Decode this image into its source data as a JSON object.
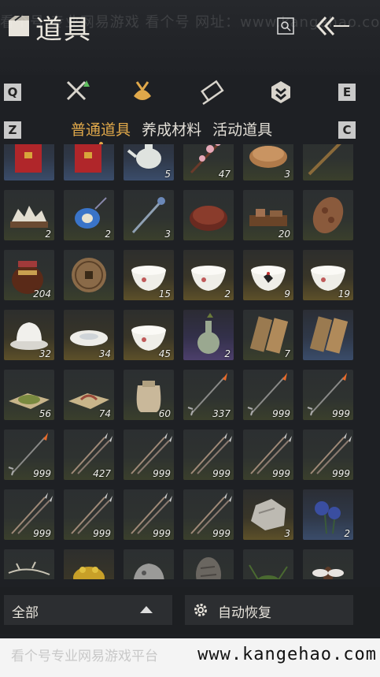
{
  "header": {
    "title": "道具",
    "watermark": "看个号  专业网易游戏  看个号  网址：www.kangehao.com"
  },
  "keys": {
    "left_top": "Q",
    "right_top": "E",
    "left_bottom": "Z",
    "right_bottom": "C"
  },
  "tabs": [
    {
      "label": "普通道具",
      "active": true
    },
    {
      "label": "养成材料",
      "active": false
    },
    {
      "label": "活动道具",
      "active": false
    }
  ],
  "items": [
    {
      "icon": "red-envelope-icon",
      "qty": "",
      "bg": "blue"
    },
    {
      "icon": "red-envelope-icon",
      "qty": "",
      "bg": "blue"
    },
    {
      "icon": "teapot-icon",
      "qty": "5",
      "bg": "blue"
    },
    {
      "icon": "flower-branch-icon",
      "qty": "47",
      "bg": ""
    },
    {
      "icon": "cake-icon",
      "qty": "3",
      "bg": ""
    },
    {
      "icon": "stick-icon",
      "qty": "",
      "bg": ""
    },
    {
      "icon": "rock-garden-icon",
      "qty": "2",
      "bg": ""
    },
    {
      "icon": "blue-pouch-icon",
      "qty": "2",
      "bg": ""
    },
    {
      "icon": "hairpin-icon",
      "qty": "3",
      "bg": ""
    },
    {
      "icon": "round-box-icon",
      "qty": "",
      "bg": ""
    },
    {
      "icon": "tray-icon",
      "qty": "20",
      "bg": ""
    },
    {
      "icon": "carved-comb-icon",
      "qty": "",
      "bg": ""
    },
    {
      "icon": "wine-jar-icon",
      "qty": "204",
      "bg": ""
    },
    {
      "icon": "bronze-coin-icon",
      "qty": "",
      "bg": ""
    },
    {
      "icon": "porcelain-bowl-icon",
      "qty": "15",
      "bg": "gold"
    },
    {
      "icon": "porcelain-bowl-icon",
      "qty": "2",
      "bg": "gold"
    },
    {
      "icon": "rooster-bowl-icon",
      "qty": "9",
      "bg": "gold"
    },
    {
      "icon": "porcelain-bowl-icon",
      "qty": "19",
      "bg": "gold"
    },
    {
      "icon": "covered-bowl-icon",
      "qty": "32",
      "bg": "gold"
    },
    {
      "icon": "dish-icon",
      "qty": "34",
      "bg": "gold"
    },
    {
      "icon": "porcelain-bowl-icon",
      "qty": "45",
      "bg": "gold"
    },
    {
      "icon": "vase-icon",
      "qty": "2",
      "bg": "purple"
    },
    {
      "icon": "wooden-tablet-icon",
      "qty": "7",
      "bg": ""
    },
    {
      "icon": "wooden-tablet-icon",
      "qty": "",
      "bg": "blue"
    },
    {
      "icon": "herb-powder-icon",
      "qty": "56",
      "bg": ""
    },
    {
      "icon": "worm-icon",
      "qty": "74",
      "bg": ""
    },
    {
      "icon": "sack-icon",
      "qty": "60",
      "bg": ""
    },
    {
      "icon": "fire-arrow-icon",
      "qty": "337",
      "bg": ""
    },
    {
      "icon": "fire-arrow-icon",
      "qty": "999",
      "bg": ""
    },
    {
      "icon": "fire-arrow-icon",
      "qty": "999",
      "bg": ""
    },
    {
      "icon": "fire-arrow-icon",
      "qty": "999",
      "bg": ""
    },
    {
      "icon": "arrow-icon",
      "qty": "427",
      "bg": ""
    },
    {
      "icon": "arrow-icon",
      "qty": "999",
      "bg": ""
    },
    {
      "icon": "arrow-icon",
      "qty": "999",
      "bg": ""
    },
    {
      "icon": "arrow-icon",
      "qty": "999",
      "bg": ""
    },
    {
      "icon": "arrow-icon",
      "qty": "999",
      "bg": ""
    },
    {
      "icon": "arrow-icon",
      "qty": "999",
      "bg": ""
    },
    {
      "icon": "arrow-icon",
      "qty": "999",
      "bg": ""
    },
    {
      "icon": "arrow-icon",
      "qty": "999",
      "bg": ""
    },
    {
      "icon": "arrow-icon",
      "qty": "999",
      "bg": ""
    },
    {
      "icon": "ore-icon",
      "qty": "3",
      "bg": "gold"
    },
    {
      "icon": "blue-flower-icon",
      "qty": "2",
      "bg": "blue"
    },
    {
      "icon": "twig-icon",
      "qty": "",
      "bg": ""
    },
    {
      "icon": "toad-icon",
      "qty": "",
      "bg": "gold"
    },
    {
      "icon": "stone-beast-icon",
      "qty": "",
      "bg": ""
    },
    {
      "icon": "dark-stone-icon",
      "qty": "",
      "bg": ""
    },
    {
      "icon": "cricket-icon",
      "qty": "",
      "bg": ""
    },
    {
      "icon": "insect-icon",
      "qty": "",
      "bg": ""
    }
  ],
  "bottom": {
    "filter_label": "全部",
    "auto_label": "自动恢复"
  },
  "footer": {
    "faded_text": "看个号专业网易游戏平台",
    "url": "www.kangehao.com"
  },
  "colors": {
    "accent": "#e0a84a",
    "panel": "#1e2024"
  }
}
